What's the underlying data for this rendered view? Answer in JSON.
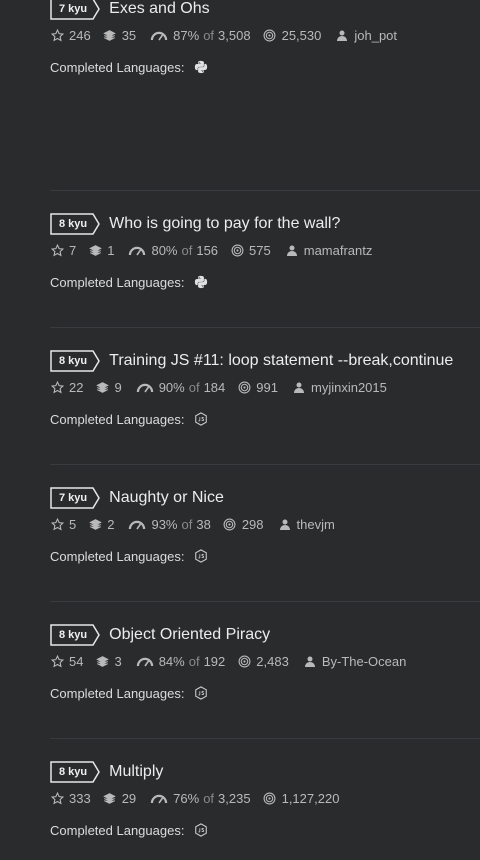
{
  "labels": {
    "completed_languages": "Completed Languages:",
    "of": "of"
  },
  "colors": {
    "background": "#2a2b2d",
    "divider": "#3a3b3e",
    "text_primary": "#ececec",
    "text_secondary": "#b9b9b9"
  },
  "katas": [
    {
      "rank": "7 kyu",
      "name": "Exes and Ohs",
      "stars": "246",
      "collections": "35",
      "satisfaction": "87%",
      "votes": "3,508",
      "completed": "25,530",
      "author": "joh_pot",
      "language_icon": "python-icon"
    },
    {
      "rank": "8 kyu",
      "name": "Who is going to pay for the wall?",
      "stars": "7",
      "collections": "1",
      "satisfaction": "80%",
      "votes": "156",
      "completed": "575",
      "author": "mamafrantz",
      "language_icon": "python-icon"
    },
    {
      "rank": "8 kyu",
      "name": "Training JS #11: loop statement --break,continue",
      "stars": "22",
      "collections": "9",
      "satisfaction": "90%",
      "votes": "184",
      "completed": "991",
      "author": "myjinxin2015",
      "language_icon": "javascript-icon"
    },
    {
      "rank": "7 kyu",
      "name": "Naughty or Nice",
      "stars": "5",
      "collections": "2",
      "satisfaction": "93%",
      "votes": "38",
      "completed": "298",
      "author": "thevjm",
      "language_icon": "javascript-icon"
    },
    {
      "rank": "8 kyu",
      "name": "Object Oriented Piracy",
      "stars": "54",
      "collections": "3",
      "satisfaction": "84%",
      "votes": "192",
      "completed": "2,483",
      "author": "By-The-Ocean",
      "language_icon": "javascript-icon"
    },
    {
      "rank": "8 kyu",
      "name": "Multiply",
      "stars": "333",
      "collections": "29",
      "satisfaction": "76%",
      "votes": "3,235",
      "completed": "1,127,220",
      "author": "",
      "language_icon": "javascript-icon"
    }
  ]
}
